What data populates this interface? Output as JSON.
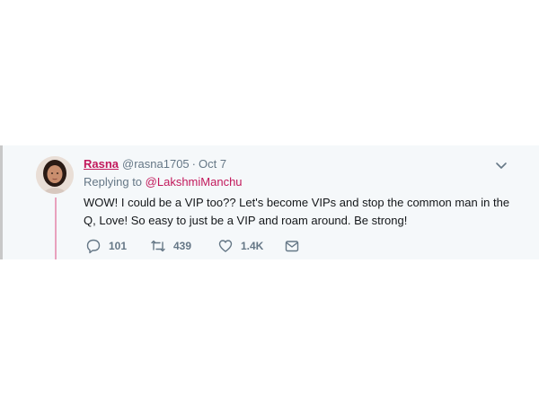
{
  "tweet": {
    "author_name": "Rasna",
    "author_handle": "@rasna1705",
    "separator": "·",
    "date": "Oct 7",
    "replying_prefix": "Replying to",
    "replying_to": "@LakshmiManchu",
    "text": "WOW! I could be a VIP too?? Let's become VIPs and stop the common man in the Q, Love! So easy to just be a VIP and roam around. Be strong!",
    "reply_count": "101",
    "retweet_count": "439",
    "like_count": "1.4K"
  },
  "icons": {
    "avatar": "avatar",
    "caret": "chevron-down-icon",
    "reply": "reply-icon",
    "retweet": "retweet-icon",
    "like": "heart-icon",
    "message": "envelope-icon"
  },
  "colors": {
    "accent": "#c2185b",
    "meta": "#657786",
    "text": "#14171a",
    "background": "#f5f8fa",
    "thread_line": "#e8a2bd"
  }
}
